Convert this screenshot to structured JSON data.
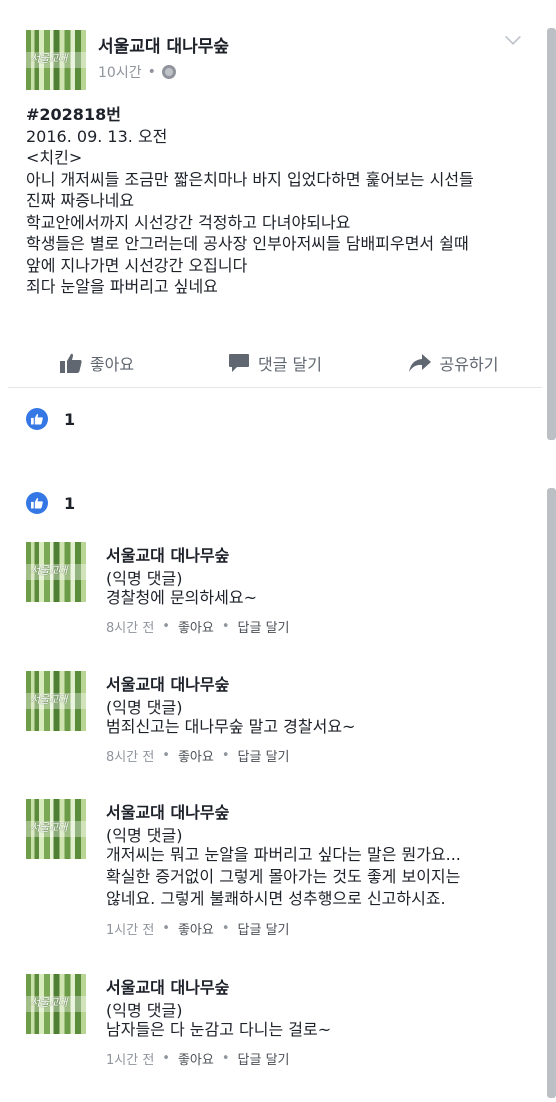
{
  "post": {
    "page_name": "서울교대 대나무숲",
    "time": "10시간",
    "separator": "•",
    "privacy_icon": "globe-icon",
    "hashtag": "#202818번",
    "date_line": "2016. 09. 13. 오전",
    "category": "<치킨>",
    "lines": [
      "아니 개저씨들 조금만 짧은치마나 바지 입었다하면 훑어보는 시선들",
      "진짜 짜증나네요",
      "학교안에서까지 시선강간 걱정하고 다녀야되나요",
      "학생들은 별로 안그러는데 공사장 인부아저씨들 담배피우면서 쉴때",
      "앞에 지나가면 시선강간 오집니다",
      "죄다 눈알을 파버리고 싶네요"
    ]
  },
  "actions": {
    "like_label": "좋아요",
    "comment_label": "댓글 달기",
    "share_label": "공유하기"
  },
  "reactions_top": {
    "count": "1"
  },
  "reactions_bottom": {
    "count": "1"
  },
  "comments": [
    {
      "name": "서울교대 대나무숲",
      "anon": "(익명 댓글)",
      "lines": [
        "경찰청에 문의하세요~"
      ],
      "time": "8시간 전",
      "like": "좋아요",
      "reply": "답글 달기"
    },
    {
      "name": "서울교대 대나무숲",
      "anon": "(익명 댓글)",
      "lines": [
        "범죄신고는 대나무숲 말고 경찰서요~"
      ],
      "time": "8시간 전",
      "like": "좋아요",
      "reply": "답글 달기"
    },
    {
      "name": "서울교대 대나무숲",
      "anon": "(익명 댓글)",
      "lines": [
        "개저씨는 뭐고 눈알을 파버리고 싶다는 말은 뭔가요...",
        "확실한 증거없이 그렇게 몰아가는 것도 좋게 보이지는",
        "않네요. 그렇게 불쾌하시면 성추행으로 신고하시죠."
      ],
      "time": "1시간 전",
      "like": "좋아요",
      "reply": "답글 달기"
    },
    {
      "name": "서울교대 대나무숲",
      "anon": "(익명 댓글)",
      "lines": [
        "남자들은 다 눈감고 다니는 걸로~"
      ],
      "time": "1시간 전",
      "like": "좋아요",
      "reply": "답글 달기"
    }
  ],
  "meta_separator": "•",
  "colors": {
    "accent": "#3578e5",
    "muted": "#90949c",
    "text": "#1d2129"
  }
}
